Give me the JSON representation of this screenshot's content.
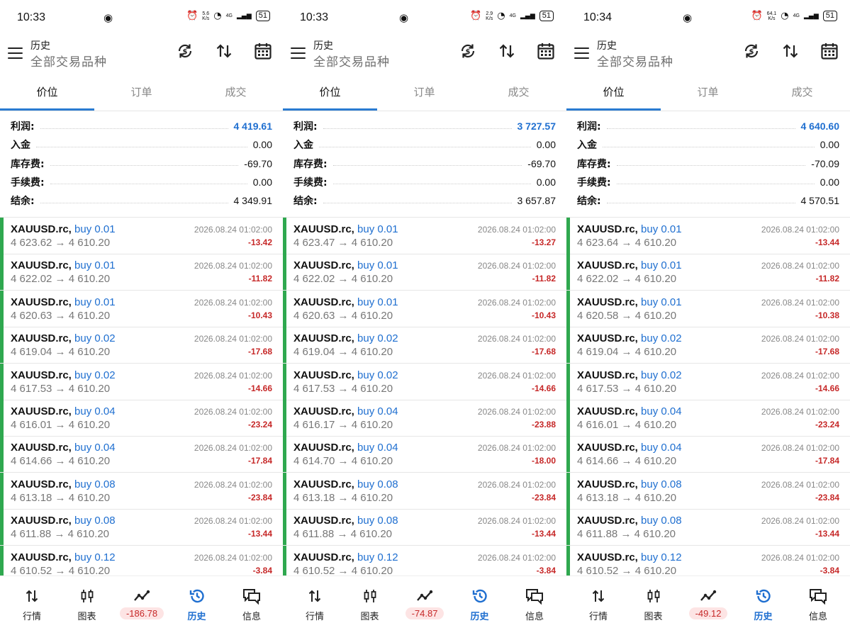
{
  "panels": [
    {
      "status": {
        "time": "10:33",
        "speed": "5.6\nK/s",
        "battery": "51",
        "net": "4G"
      },
      "header": {
        "title": "历史",
        "subtitle": "全部交易品种"
      },
      "tabs": [
        "价位",
        "订单",
        "成交"
      ],
      "summary": [
        {
          "label": "利润:",
          "value": "4 419.61",
          "blue": true
        },
        {
          "label": "入金",
          "value": "0.00"
        },
        {
          "label": "库存费:",
          "value": "-69.70"
        },
        {
          "label": "手续费:",
          "value": "0.00"
        },
        {
          "label": "结余:",
          "value": "4 349.91"
        }
      ],
      "rows": [
        {
          "symbol": "XAUUSD.rc,",
          "side": "buy 0.01",
          "prices": "4 623.62 → 4 610.20",
          "time": "2026.08.24 01:02:00",
          "pl": "-13.42"
        },
        {
          "symbol": "XAUUSD.rc,",
          "side": "buy 0.01",
          "prices": "4 622.02 → 4 610.20",
          "time": "2026.08.24 01:02:00",
          "pl": "-11.82"
        },
        {
          "symbol": "XAUUSD.rc,",
          "side": "buy 0.01",
          "prices": "4 620.63 → 4 610.20",
          "time": "2026.08.24 01:02:00",
          "pl": "-10.43"
        },
        {
          "symbol": "XAUUSD.rc,",
          "side": "buy 0.02",
          "prices": "4 619.04 → 4 610.20",
          "time": "2026.08.24 01:02:00",
          "pl": "-17.68"
        },
        {
          "symbol": "XAUUSD.rc,",
          "side": "buy 0.02",
          "prices": "4 617.53 → 4 610.20",
          "time": "2026.08.24 01:02:00",
          "pl": "-14.66"
        },
        {
          "symbol": "XAUUSD.rc,",
          "side": "buy 0.04",
          "prices": "4 616.01 → 4 610.20",
          "time": "2026.08.24 01:02:00",
          "pl": "-23.24"
        },
        {
          "symbol": "XAUUSD.rc,",
          "side": "buy 0.04",
          "prices": "4 614.66 → 4 610.20",
          "time": "2026.08.24 01:02:00",
          "pl": "-17.84"
        },
        {
          "symbol": "XAUUSD.rc,",
          "side": "buy 0.08",
          "prices": "4 613.18 → 4 610.20",
          "time": "2026.08.24 01:02:00",
          "pl": "-23.84"
        },
        {
          "symbol": "XAUUSD.rc,",
          "side": "buy 0.08",
          "prices": "4 611.88 → 4 610.20",
          "time": "2026.08.24 01:02:00",
          "pl": "-13.44"
        },
        {
          "symbol": "XAUUSD.rc,",
          "side": "buy 0.12",
          "prices": "4 610.52 → 4 610.20",
          "time": "2026.08.24 01:02:00",
          "pl": "-3.84"
        }
      ],
      "nav": [
        {
          "label": "行情",
          "icon": "quotes-icon"
        },
        {
          "label": "图表",
          "icon": "chart-icon"
        },
        {
          "label": "-186.78",
          "icon": "trade-icon",
          "badge": true
        },
        {
          "label": "历史",
          "icon": "history-icon",
          "active": true
        },
        {
          "label": "信息",
          "icon": "messages-icon"
        }
      ]
    },
    {
      "status": {
        "time": "10:33",
        "speed": "2.9\nK/s",
        "battery": "51",
        "net": "4G"
      },
      "header": {
        "title": "历史",
        "subtitle": "全部交易品种"
      },
      "tabs": [
        "价位",
        "订单",
        "成交"
      ],
      "summary": [
        {
          "label": "利润:",
          "value": "3 727.57",
          "blue": true
        },
        {
          "label": "入金",
          "value": "0.00"
        },
        {
          "label": "库存费:",
          "value": "-69.70"
        },
        {
          "label": "手续费:",
          "value": "0.00"
        },
        {
          "label": "结余:",
          "value": "3 657.87"
        }
      ],
      "rows": [
        {
          "symbol": "XAUUSD.rc,",
          "side": "buy 0.01",
          "prices": "4 623.47 → 4 610.20",
          "time": "2026.08.24 01:02:00",
          "pl": "-13.27"
        },
        {
          "symbol": "XAUUSD.rc,",
          "side": "buy 0.01",
          "prices": "4 622.02 → 4 610.20",
          "time": "2026.08.24 01:02:00",
          "pl": "-11.82"
        },
        {
          "symbol": "XAUUSD.rc,",
          "side": "buy 0.01",
          "prices": "4 620.63 → 4 610.20",
          "time": "2026.08.24 01:02:00",
          "pl": "-10.43"
        },
        {
          "symbol": "XAUUSD.rc,",
          "side": "buy 0.02",
          "prices": "4 619.04 → 4 610.20",
          "time": "2026.08.24 01:02:00",
          "pl": "-17.68"
        },
        {
          "symbol": "XAUUSD.rc,",
          "side": "buy 0.02",
          "prices": "4 617.53 → 4 610.20",
          "time": "2026.08.24 01:02:00",
          "pl": "-14.66"
        },
        {
          "symbol": "XAUUSD.rc,",
          "side": "buy 0.04",
          "prices": "4 616.17 → 4 610.20",
          "time": "2026.08.24 01:02:00",
          "pl": "-23.88"
        },
        {
          "symbol": "XAUUSD.rc,",
          "side": "buy 0.04",
          "prices": "4 614.70 → 4 610.20",
          "time": "2026.08.24 01:02:00",
          "pl": "-18.00"
        },
        {
          "symbol": "XAUUSD.rc,",
          "side": "buy 0.08",
          "prices": "4 613.18 → 4 610.20",
          "time": "2026.08.24 01:02:00",
          "pl": "-23.84"
        },
        {
          "symbol": "XAUUSD.rc,",
          "side": "buy 0.08",
          "prices": "4 611.88 → 4 610.20",
          "time": "2026.08.24 01:02:00",
          "pl": "-13.44"
        },
        {
          "symbol": "XAUUSD.rc,",
          "side": "buy 0.12",
          "prices": "4 610.52 → 4 610.20",
          "time": "2026.08.24 01:02:00",
          "pl": "-3.84"
        }
      ],
      "nav": [
        {
          "label": "行情",
          "icon": "quotes-icon"
        },
        {
          "label": "图表",
          "icon": "chart-icon"
        },
        {
          "label": "-74.87",
          "icon": "trade-icon",
          "badge": true
        },
        {
          "label": "历史",
          "icon": "history-icon",
          "active": true
        },
        {
          "label": "信息",
          "icon": "messages-icon"
        }
      ]
    },
    {
      "status": {
        "time": "10:34",
        "speed": "64.1\nK/s",
        "battery": "51",
        "net": "4G"
      },
      "header": {
        "title": "历史",
        "subtitle": "全部交易品种"
      },
      "tabs": [
        "价位",
        "订单",
        "成交"
      ],
      "summary": [
        {
          "label": "利润:",
          "value": "4 640.60",
          "blue": true
        },
        {
          "label": "入金",
          "value": "0.00"
        },
        {
          "label": "库存费:",
          "value": "-70.09"
        },
        {
          "label": "手续费:",
          "value": "0.00"
        },
        {
          "label": "结余:",
          "value": "4 570.51"
        }
      ],
      "rows": [
        {
          "symbol": "XAUUSD.rc,",
          "side": "buy 0.01",
          "prices": "4 623.64 → 4 610.20",
          "time": "2026.08.24 01:02:00",
          "pl": "-13.44"
        },
        {
          "symbol": "XAUUSD.rc,",
          "side": "buy 0.01",
          "prices": "4 622.02 → 4 610.20",
          "time": "2026.08.24 01:02:00",
          "pl": "-11.82"
        },
        {
          "symbol": "XAUUSD.rc,",
          "side": "buy 0.01",
          "prices": "4 620.58 → 4 610.20",
          "time": "2026.08.24 01:02:00",
          "pl": "-10.38"
        },
        {
          "symbol": "XAUUSD.rc,",
          "side": "buy 0.02",
          "prices": "4 619.04 → 4 610.20",
          "time": "2026.08.24 01:02:00",
          "pl": "-17.68"
        },
        {
          "symbol": "XAUUSD.rc,",
          "side": "buy 0.02",
          "prices": "4 617.53 → 4 610.20",
          "time": "2026.08.24 01:02:00",
          "pl": "-14.66"
        },
        {
          "symbol": "XAUUSD.rc,",
          "side": "buy 0.04",
          "prices": "4 616.01 → 4 610.20",
          "time": "2026.08.24 01:02:00",
          "pl": "-23.24"
        },
        {
          "symbol": "XAUUSD.rc,",
          "side": "buy 0.04",
          "prices": "4 614.66 → 4 610.20",
          "time": "2026.08.24 01:02:00",
          "pl": "-17.84"
        },
        {
          "symbol": "XAUUSD.rc,",
          "side": "buy 0.08",
          "prices": "4 613.18 → 4 610.20",
          "time": "2026.08.24 01:02:00",
          "pl": "-23.84"
        },
        {
          "symbol": "XAUUSD.rc,",
          "side": "buy 0.08",
          "prices": "4 611.88 → 4 610.20",
          "time": "2026.08.24 01:02:00",
          "pl": "-13.44"
        },
        {
          "symbol": "XAUUSD.rc,",
          "side": "buy 0.12",
          "prices": "4 610.52 → 4 610.20",
          "time": "2026.08.24 01:02:00",
          "pl": "-3.84"
        }
      ],
      "nav": [
        {
          "label": "行情",
          "icon": "quotes-icon"
        },
        {
          "label": "图表",
          "icon": "chart-icon"
        },
        {
          "label": "-49.12",
          "icon": "trade-icon",
          "badge": true
        },
        {
          "label": "历史",
          "icon": "history-icon",
          "active": true
        },
        {
          "label": "信息",
          "icon": "messages-icon"
        }
      ]
    }
  ],
  "colors": {
    "accent": "#1f6fd0",
    "loss": "#c62828",
    "buy_bar": "#2fa84f",
    "indicator": "#2a7bd1"
  }
}
